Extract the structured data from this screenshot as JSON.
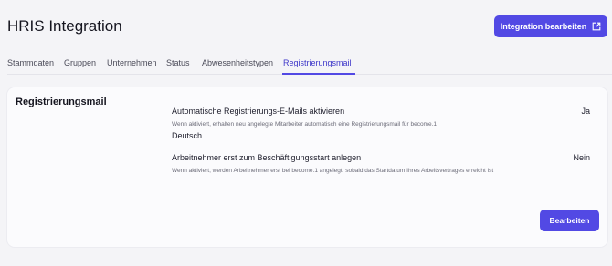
{
  "header": {
    "title": "HRIS Integration",
    "edit_integration_label": "Integration bearbeiten",
    "edit_integration_icon": "external-link-icon"
  },
  "tabs": [
    {
      "label": "Stammdaten",
      "active": false
    },
    {
      "label": "Gruppen",
      "active": false
    },
    {
      "label": "Unternehmen",
      "active": false
    },
    {
      "label": "Status",
      "active": false
    },
    {
      "label": "Abwesenheitstypen",
      "active": false
    },
    {
      "label": "Registrierungsmail",
      "active": true
    }
  ],
  "card": {
    "title": "Registrierungsmail",
    "settings": [
      {
        "label": "Automatische Registrierungs-E-Mails aktivieren",
        "description": "Wenn aktiviert, erhalten neu angelegte Mitarbeiter automatisch eine Registrierungsmail für become.1",
        "value": "Ja"
      },
      {
        "label": "Deutsch"
      },
      {
        "label": "Arbeitnehmer erst zum Beschäftigungsstart anlegen",
        "description": "Wenn aktiviert, werden Arbeitnehmer erst bei become.1 angelegt, sobald das Startdatum Ihres Arbeitsvertrages erreicht ist",
        "value": "Nein"
      }
    ],
    "edit_label": "Bearbeiten"
  },
  "colors": {
    "accent": "#5249e4",
    "background": "#f4f4f7",
    "card": "#fbfbfd"
  }
}
